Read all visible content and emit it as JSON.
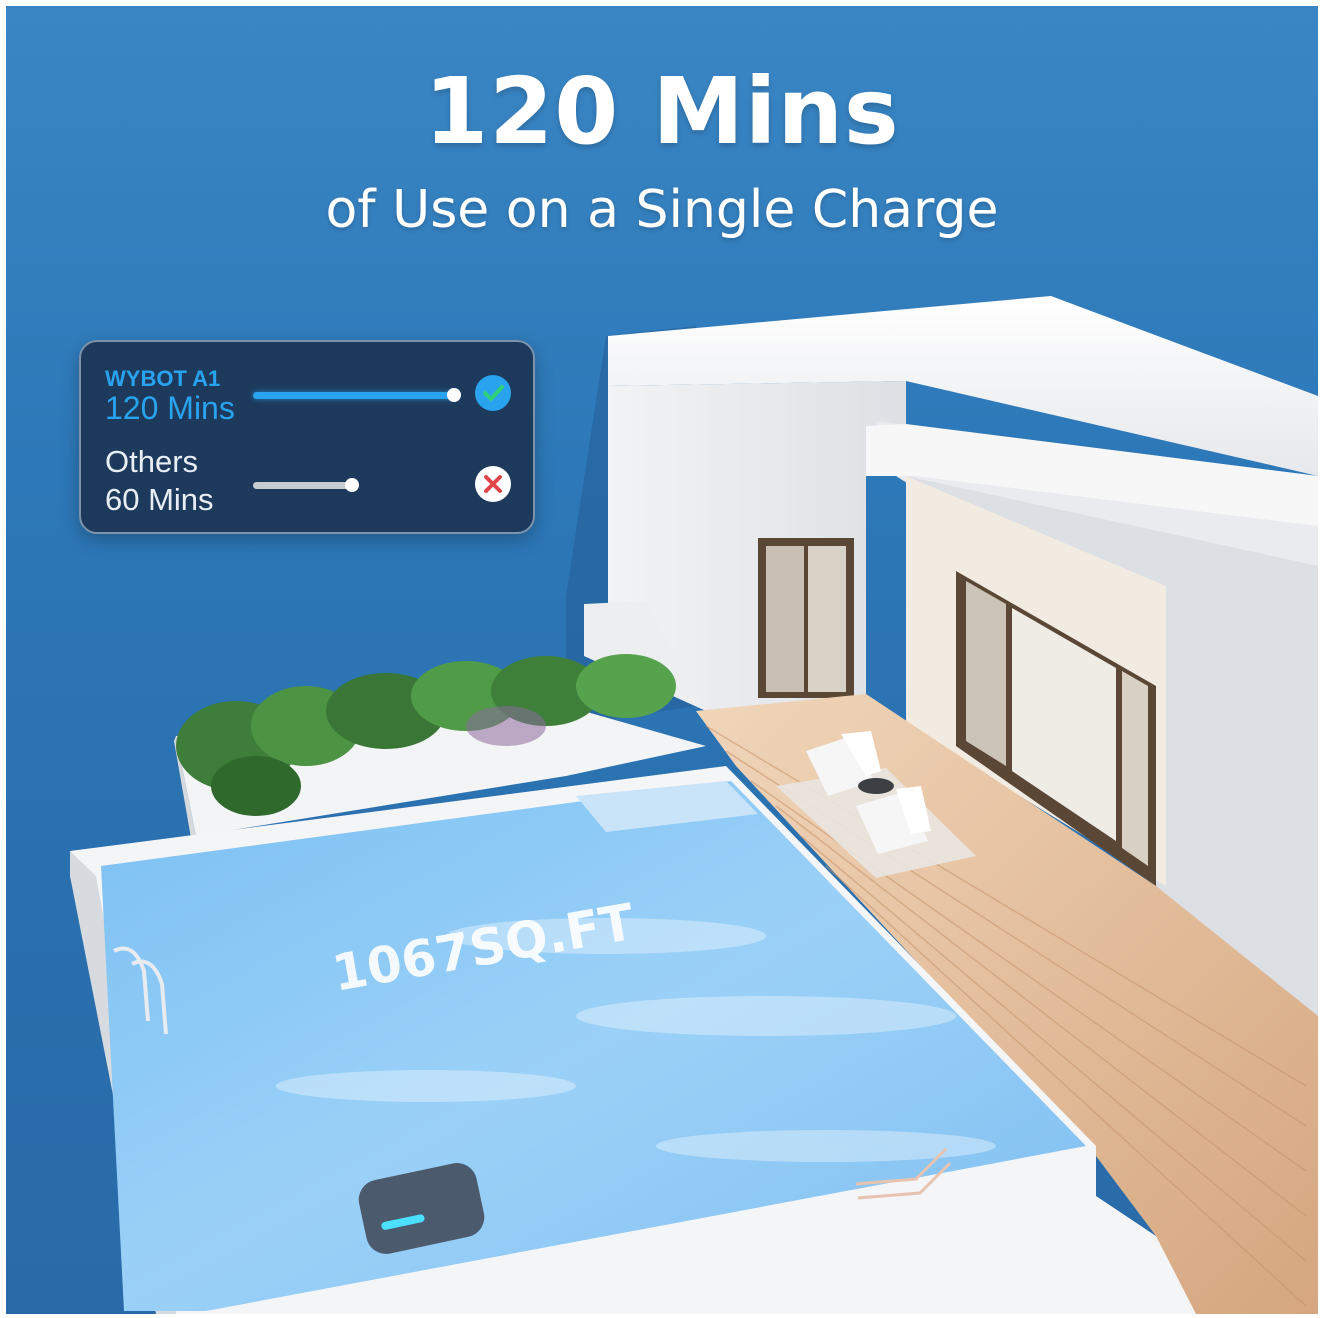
{
  "hero": {
    "headline": "120 Mins",
    "subheadline": "of Use on a Single Charge"
  },
  "comparison": {
    "primary": {
      "name": "WYBOT A1",
      "runtime": "120 Mins",
      "minutes": 120
    },
    "secondary": {
      "name": "Others",
      "runtime": "60 Mins",
      "minutes": 60
    },
    "max_minutes": 120
  },
  "pool_area_label": "1067SQ.FT",
  "colors": {
    "accent_blue": "#2aa3ef",
    "card_bg": "#1d3a5c",
    "cross_red": "#e0454a",
    "background_blue": "#2d78b8"
  },
  "icons": {
    "primary_status": "check-icon",
    "secondary_status": "cross-icon"
  }
}
